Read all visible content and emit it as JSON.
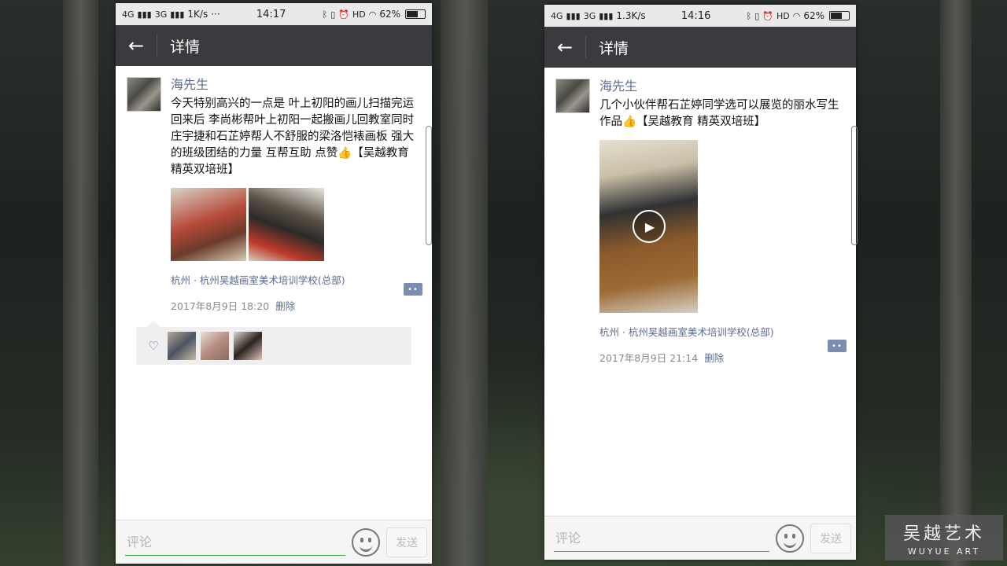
{
  "screens": [
    {
      "status": {
        "network": "4G",
        "network2": "3G",
        "speed": "1K/s",
        "dots": "···",
        "time": "14:17",
        "hd": "HD",
        "battery": "62%"
      },
      "nav_title": "详情",
      "post": {
        "author": "海先生",
        "text": "今天特别高兴的一点是 叶上初阳的画儿扫描完运回来后 李尚彬帮叶上初阳一起搬画儿回教室同时 庄宇捷和石芷婷帮人不舒服的梁洛恺裱画板 强大的班级团结的力量 互帮互助 点赞👍【吴越教育 精英双培班】",
        "location": "杭州 · 杭州吴越画室美术培训学校(总部)",
        "time": "2017年8月9日 18:20",
        "delete": "删除"
      },
      "comment_placeholder": "评论",
      "send": "发送"
    },
    {
      "status": {
        "network": "4G",
        "network2": "3G",
        "speed": "1.3K/s",
        "time": "14:16",
        "hd": "HD",
        "battery": "62%"
      },
      "nav_title": "详情",
      "post": {
        "author": "海先生",
        "text": "几个小伙伴帮石芷婷同学选可以展览的丽水写生作品👍【吴越教育 精英双培班】",
        "location": "杭州 · 杭州吴越画室美术培训学校(总部)",
        "time": "2017年8月9日 21:14",
        "delete": "删除"
      },
      "comment_placeholder": "评论",
      "send": "发送"
    }
  ],
  "watermark": {
    "title": "吴越艺术",
    "subtitle": "WUYUE ART"
  },
  "icons": [
    "back-arrow-icon",
    "bluetooth-icon",
    "vibrate-icon",
    "alarm-icon",
    "wifi-icon",
    "battery-icon",
    "comment-icon",
    "heart-icon",
    "play-icon",
    "emoji-icon"
  ]
}
